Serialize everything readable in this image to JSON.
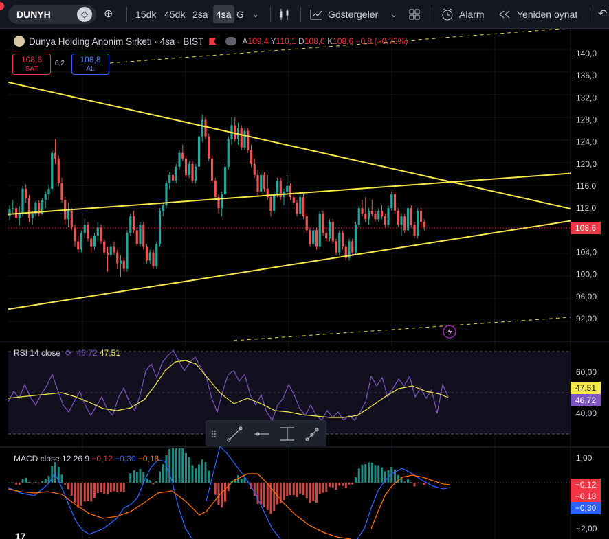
{
  "toolbar": {
    "symbol": "DUNYH",
    "intervals": [
      "15dk",
      "45dk",
      "2sa",
      "4sa",
      "G"
    ],
    "active_interval": "4sa",
    "indicators_label": "Göstergeler",
    "alarm_label": "Alarm",
    "replay_label": "Yeniden oynat"
  },
  "legend": {
    "title": "Dunya Holding Anonim Sirketi · 4sa · BIST",
    "open_key": "A",
    "open": "109,4",
    "high_key": "Y",
    "high": "110,1",
    "low_key": "D",
    "low": "108,0",
    "close_key": "K",
    "close": "108,6",
    "change": "−0,8 (−0,73%)"
  },
  "trade": {
    "sell_price": "108,6",
    "sell_label": "SAT",
    "spread": "0,2",
    "buy_price": "108,8",
    "buy_label": "AL"
  },
  "price_axis": [
    "140,0",
    "136,0",
    "132,0",
    "128,0",
    "124,0",
    "120,0",
    "116,0",
    "112,0",
    "104,0",
    "100,0",
    "96,00",
    "92,00"
  ],
  "last_price_tag": "108,6",
  "rsi": {
    "label": "RSI 14 close",
    "value_rsi": "46,72",
    "value_ma": "47,51",
    "axis": [
      "60,00",
      "40,00"
    ]
  },
  "macd": {
    "label": "MACD close 12 26 9",
    "hist": "−0,12",
    "macd": "−0,30",
    "signal": "−0,18",
    "axis": [
      "1,00",
      "−2,00"
    ],
    "tag_hist": "−0,12",
    "tag_signal": "−0,18",
    "tag_macd": "−0,30"
  },
  "colors": {
    "up": "#26a69a",
    "down": "#ef5350",
    "trendline": "#f5e94a",
    "rsi": "#7e57c2",
    "rsi_ma": "#f5e94a",
    "macd": "#2962ff",
    "signal": "#ff6d00"
  },
  "chart_data": {
    "type": "candlestick",
    "ylim": [
      90.0,
      141.5
    ],
    "candles": [
      [
        110.6,
        112.5,
        109.8,
        111.8
      ],
      [
        111.8,
        113.5,
        111.0,
        112.0
      ],
      [
        112.0,
        113.2,
        109.5,
        110.2
      ],
      [
        110.2,
        112.4,
        108.8,
        111.0
      ],
      [
        111.0,
        116.0,
        110.5,
        115.5
      ],
      [
        115.5,
        116.3,
        113.0,
        113.8
      ],
      [
        113.8,
        114.4,
        109.5,
        110.2
      ],
      [
        110.2,
        111.5,
        109.0,
        111.0
      ],
      [
        111.0,
        113.3,
        110.5,
        113.0
      ],
      [
        113.0,
        113.5,
        110.5,
        111.0
      ],
      [
        111.0,
        113.8,
        110.8,
        113.5
      ],
      [
        113.5,
        115.0,
        112.0,
        114.5
      ],
      [
        114.5,
        116.3,
        113.5,
        115.5
      ],
      [
        115.5,
        122.5,
        115.0,
        122.0
      ],
      [
        122.0,
        124.5,
        120.0,
        121.0
      ],
      [
        121.0,
        121.5,
        116.0,
        116.5
      ],
      [
        116.5,
        117.5,
        113.0,
        113.5
      ],
      [
        113.5,
        114.0,
        109.0,
        110.0
      ],
      [
        110.0,
        113.0,
        108.5,
        111.5
      ],
      [
        111.5,
        112.0,
        108.0,
        108.5
      ],
      [
        108.5,
        109.0,
        105.0,
        106.0
      ],
      [
        106.0,
        107.0,
        104.0,
        104.5
      ],
      [
        104.5,
        108.0,
        104.0,
        107.5
      ],
      [
        107.5,
        110.0,
        106.5,
        109.0
      ],
      [
        109.0,
        109.5,
        106.0,
        106.5
      ],
      [
        106.5,
        107.0,
        104.0,
        105.0
      ],
      [
        105.0,
        107.5,
        104.5,
        107.0
      ],
      [
        107.0,
        109.5,
        106.0,
        108.5
      ],
      [
        108.5,
        109.0,
        105.5,
        106.0
      ],
      [
        106.0,
        106.5,
        103.5,
        104.0
      ],
      [
        104.0,
        105.0,
        100.5,
        103.5
      ],
      [
        103.5,
        105.5,
        103.0,
        105.0
      ],
      [
        105.0,
        106.0,
        103.5,
        104.0
      ],
      [
        104.0,
        104.5,
        101.0,
        102.0
      ],
      [
        102.0,
        103.5,
        99.5,
        102.5
      ],
      [
        102.5,
        103.0,
        100.5,
        101.0
      ],
      [
        101.0,
        108.0,
        100.5,
        107.5
      ],
      [
        107.5,
        111.0,
        107.0,
        110.5
      ],
      [
        110.5,
        111.5,
        107.5,
        108.0
      ],
      [
        108.0,
        108.5,
        105.0,
        105.5
      ],
      [
        105.5,
        109.5,
        105.0,
        109.0
      ],
      [
        109.0,
        109.5,
        104.5,
        105.0
      ],
      [
        105.0,
        105.5,
        102.0,
        102.5
      ],
      [
        102.5,
        104.5,
        102.0,
        104.0
      ],
      [
        104.0,
        104.5,
        101.0,
        101.5
      ],
      [
        101.5,
        106.0,
        101.0,
        105.5
      ],
      [
        105.5,
        112.0,
        105.0,
        111.5
      ],
      [
        111.5,
        113.0,
        110.5,
        112.5
      ],
      [
        112.5,
        117.0,
        112.0,
        116.5
      ],
      [
        116.5,
        118.5,
        115.5,
        118.0
      ],
      [
        118.0,
        119.5,
        116.5,
        117.0
      ],
      [
        117.0,
        120.0,
        116.5,
        119.5
      ],
      [
        119.5,
        122.5,
        119.0,
        122.0
      ],
      [
        122.0,
        123.5,
        120.5,
        121.0
      ],
      [
        121.0,
        121.5,
        117.5,
        118.0
      ],
      [
        118.0,
        120.5,
        117.5,
        120.0
      ],
      [
        120.0,
        120.5,
        116.5,
        117.0
      ],
      [
        117.0,
        120.0,
        116.5,
        119.5
      ],
      [
        119.5,
        125.5,
        119.0,
        125.0
      ],
      [
        125.0,
        129.0,
        124.0,
        128.0
      ],
      [
        128.0,
        128.5,
        124.5,
        125.0
      ],
      [
        125.0,
        125.5,
        120.5,
        121.0
      ],
      [
        121.0,
        121.5,
        116.5,
        117.0
      ],
      [
        117.0,
        117.5,
        113.5,
        114.0
      ],
      [
        114.0,
        114.5,
        111.0,
        112.0
      ],
      [
        112.0,
        115.0,
        110.5,
        114.5
      ],
      [
        114.5,
        120.0,
        114.0,
        119.5
      ],
      [
        119.5,
        125.0,
        119.0,
        124.5
      ],
      [
        124.5,
        128.5,
        123.5,
        127.0
      ],
      [
        127.0,
        128.5,
        124.0,
        124.5
      ],
      [
        124.5,
        127.5,
        123.5,
        126.5
      ],
      [
        126.5,
        127.0,
        122.5,
        123.0
      ],
      [
        123.0,
        126.5,
        122.5,
        126.0
      ],
      [
        126.0,
        126.5,
        122.0,
        122.5
      ],
      [
        122.5,
        123.5,
        119.5,
        120.0
      ],
      [
        120.0,
        121.0,
        117.5,
        118.0
      ],
      [
        118.0,
        119.0,
        114.0,
        115.0
      ],
      [
        115.0,
        118.5,
        114.5,
        118.0
      ],
      [
        118.0,
        118.5,
        115.0,
        115.5
      ],
      [
        115.5,
        118.0,
        113.5,
        114.0
      ],
      [
        114.0,
        114.5,
        110.5,
        111.5
      ],
      [
        111.5,
        115.0,
        111.0,
        114.5
      ],
      [
        114.5,
        117.5,
        114.0,
        117.0
      ],
      [
        117.0,
        117.5,
        113.5,
        114.0
      ],
      [
        114.0,
        115.5,
        112.5,
        115.0
      ],
      [
        115.0,
        118.0,
        114.5,
        116.0
      ],
      [
        116.0,
        116.5,
        113.5,
        114.0
      ],
      [
        114.0,
        115.0,
        112.5,
        113.0
      ],
      [
        113.0,
        113.5,
        110.5,
        111.0
      ],
      [
        111.0,
        114.5,
        110.5,
        114.0
      ],
      [
        114.0,
        114.5,
        110.0,
        110.5
      ],
      [
        110.5,
        111.0,
        107.5,
        108.0
      ],
      [
        108.0,
        108.5,
        105.0,
        105.5
      ],
      [
        105.5,
        108.5,
        105.0,
        108.0
      ],
      [
        108.0,
        108.5,
        104.5,
        105.0
      ],
      [
        105.0,
        111.5,
        104.5,
        111.0
      ],
      [
        111.0,
        111.5,
        107.0,
        107.5
      ],
      [
        107.5,
        108.5,
        106.0,
        106.5
      ],
      [
        106.5,
        110.0,
        106.0,
        109.5
      ],
      [
        109.5,
        110.0,
        105.5,
        106.0
      ],
      [
        106.0,
        106.5,
        103.5,
        104.0
      ],
      [
        104.0,
        108.0,
        103.5,
        107.5
      ],
      [
        107.5,
        108.0,
        104.5,
        105.0
      ],
      [
        105.0,
        105.5,
        102.5,
        103.0
      ],
      [
        103.0,
        106.5,
        102.5,
        106.0
      ],
      [
        106.0,
        106.5,
        103.5,
        104.0
      ],
      [
        104.0,
        109.5,
        103.5,
        109.0
      ],
      [
        109.0,
        112.5,
        108.5,
        112.0
      ],
      [
        112.0,
        113.5,
        110.5,
        111.0
      ],
      [
        111.0,
        114.0,
        109.5,
        110.0
      ],
      [
        110.0,
        112.0,
        109.0,
        111.5
      ],
      [
        111.5,
        113.5,
        110.5,
        111.0
      ],
      [
        111.0,
        111.5,
        109.5,
        110.0
      ],
      [
        110.0,
        112.0,
        109.5,
        111.5
      ],
      [
        111.5,
        112.5,
        110.0,
        110.5
      ],
      [
        110.5,
        111.0,
        108.5,
        109.0
      ],
      [
        109.0,
        112.5,
        108.5,
        112.0
      ],
      [
        112.0,
        115.0,
        111.5,
        114.5
      ],
      [
        114.5,
        115.0,
        111.0,
        111.5
      ],
      [
        111.5,
        112.0,
        108.5,
        109.0
      ],
      [
        109.0,
        111.0,
        107.0,
        110.5
      ],
      [
        110.5,
        111.0,
        107.5,
        108.0
      ],
      [
        108.0,
        112.5,
        107.5,
        112.0
      ],
      [
        112.0,
        112.5,
        108.5,
        109.0
      ],
      [
        109.0,
        109.5,
        106.5,
        107.0
      ],
      [
        107.0,
        112.0,
        106.5,
        111.5
      ],
      [
        111.5,
        112.0,
        108.5,
        109.5
      ],
      [
        109.5,
        110.0,
        108.0,
        108.6
      ]
    ],
    "trendlines": [
      {
        "from": [
          0,
          134.8
        ],
        "to": [
          135,
          111.9
        ]
      },
      {
        "from": [
          0,
          110.9
        ],
        "to": [
          135,
          118.3
        ]
      },
      {
        "from": [
          0,
          93.7
        ],
        "to": [
          135,
          109.7
        ]
      }
    ]
  }
}
